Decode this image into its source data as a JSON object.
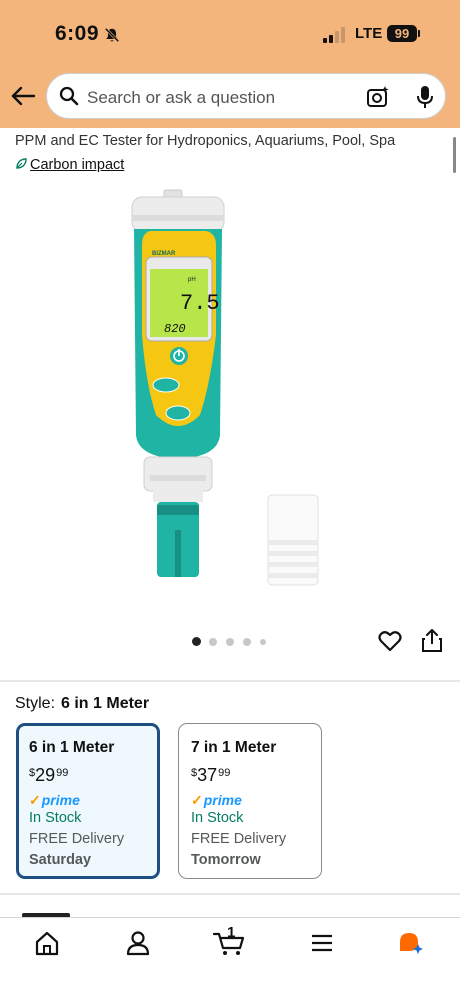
{
  "status_bar": {
    "time": "6:09",
    "network": "LTE",
    "battery": "99",
    "icons": [
      "bell-slash-icon",
      "signal-icon"
    ]
  },
  "header": {
    "search_placeholder": "Search or ask a question",
    "icons": [
      "back-arrow-icon",
      "search-icon",
      "camera-icon",
      "microphone-icon"
    ]
  },
  "product": {
    "title_partial": "PPM and EC Tester for Hydroponics, Aquariums, Pool, Spa",
    "carbon_impact": "Carbon impact",
    "image_dots": 5,
    "image_index": 1,
    "device_display": {
      "brand": "BIZMAR",
      "ph_label": "pH",
      "ph_value": "7.5",
      "ec_value": "820"
    }
  },
  "style": {
    "label": "Style:",
    "selected": "6 in 1 Meter",
    "options": [
      {
        "name": "6 in 1 Meter",
        "currency": "$",
        "price_whole": "29",
        "price_fraction": "99",
        "prime": "prime",
        "stock": "In Stock",
        "delivery": "FREE Delivery",
        "day": "Saturday",
        "selected": true
      },
      {
        "name": "7 in 1 Meter",
        "currency": "$",
        "price_whole": "37",
        "price_fraction": "99",
        "prime": "prime",
        "stock": "In Stock",
        "delivery": "FREE Delivery",
        "day": "Tomorrow",
        "selected": false
      }
    ]
  },
  "bottom_nav": {
    "cart_count": "1",
    "items": [
      "home-icon",
      "account-icon",
      "cart-icon",
      "menu-icon",
      "rufus-assistant-icon"
    ]
  },
  "colors": {
    "header_bg": "#f4b57d",
    "selected_border": "#1f4f82",
    "selected_bg": "#eef8fd",
    "in_stock": "#067d62",
    "prime_blue": "#1a98ff",
    "device_teal": "#1fb4a3",
    "lcd_green": "#b6e64a"
  }
}
